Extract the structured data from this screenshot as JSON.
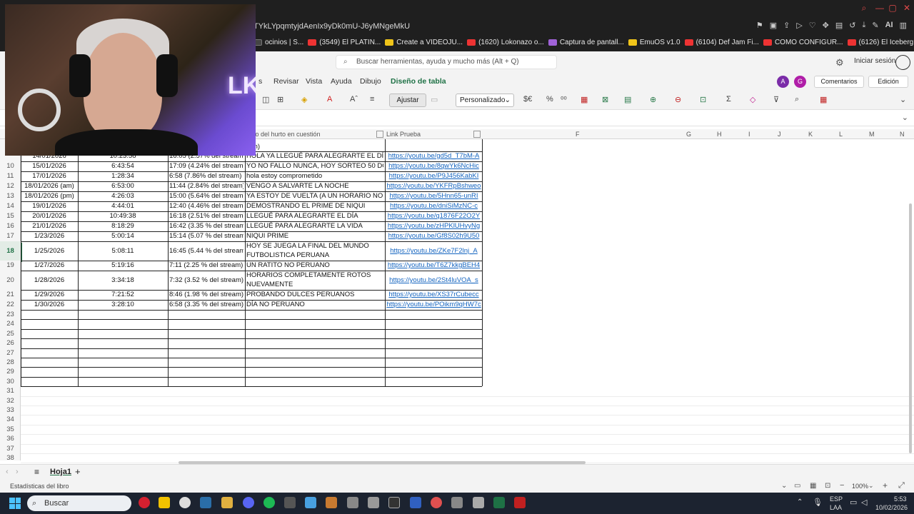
{
  "browser": {
    "url_fragment": "TYkLYpqmtyjdAenIx9yDk0mU-J6yMNgeMkU",
    "bookmarks": [
      {
        "label": "ocinios | S...",
        "icon": "dark"
      },
      {
        "label": "(3549) El PLATIN...",
        "icon": "red"
      },
      {
        "label": "Create a VIDEOJU...",
        "icon": "yellow"
      },
      {
        "label": "(1620) Lokonazo o...",
        "icon": "red"
      },
      {
        "label": "Captura de pantall...",
        "icon": "purple"
      },
      {
        "label": "EmuOS v1.0",
        "icon": "yellow"
      },
      {
        "label": "(6104) Def Jam Fi...",
        "icon": "red"
      },
      {
        "label": "COMO CONFIGUR...",
        "icon": "red"
      },
      {
        "label": "(6126) El Iceberg...",
        "icon": "red"
      }
    ],
    "ai_label": "AI"
  },
  "excel": {
    "search_placeholder": "Buscar herramientas, ayuda y mucho más (Alt + Q)",
    "signin": "Iniciar sesión",
    "menu": {
      "tab_s": "s",
      "revisar": "Revisar",
      "vista": "Vista",
      "ayuda": "Ayuda",
      "dibujo": "Dibujo",
      "diseno": "Diseño de tabla"
    },
    "comments": "Comentarios",
    "edit_mode": "Edición",
    "toolbar": {
      "ajustar": "Ajustar",
      "format": "Personalizado"
    },
    "col_headers": {
      "d": "to del hurto en cuestión",
      "e": "Link Prueba",
      "f": "F",
      "g": "G",
      "h": "H",
      "i": "I",
      "j": "J",
      "k": "K",
      "l": "L",
      "m": "M",
      "n": "N"
    },
    "partial_row_top": {
      "a": "14/01/2026",
      "b": "10:23:58",
      "c": "16:05 (2.57% del stream)",
      "d": "HOLA YA LLEGUÉ PARA ALEGRARTE EL DÍA",
      "e": "https://youtu.be/gd5d_T7bM-A",
      "d_above": "ean)"
    },
    "rows": [
      {
        "n": "10",
        "date": "15/01/2026",
        "duration": "6:43:54",
        "time": "17:09 (4.24% del stream)",
        "title": "YO NO FALLO NUNCA, HOY SORTEO 50 DOLARES",
        "link": "https://youtu.be/8qwYk6NcHic"
      },
      {
        "n": "11",
        "date": "17/01/2026",
        "duration": "1:28:34",
        "time": "6:58 (7.86% del stream)",
        "title": "hola estoy comprometido",
        "link": "https://youtu.be/P9J456KabKI"
      },
      {
        "n": "12",
        "date": "18/01/2026 (am)",
        "duration": "6:53:00",
        "time": "11:44 (2.84% del stream)",
        "title": "VENGO A SALVARTE LA NOCHE",
        "link": "https://youtu.be/YKFRpBshweo"
      },
      {
        "n": "13",
        "date": "18/01/2026 (pm)",
        "duration": "4:26:03",
        "time": "15:00 (5.64% del stream)",
        "title": "YA ESTOY DE VUELTA (A UN HORARIO NORMAL)",
        "link": "https://youtu.be/5Hnn65-unRI"
      },
      {
        "n": "14",
        "date": "19/01/2026",
        "duration": "4:44:01",
        "time": "12:40 (4.46% del stream)",
        "title": "DEMOSTRANDO EL PRIME DE NIQUI",
        "link": "https://youtu.be/dniSiMzNC-c"
      },
      {
        "n": "15",
        "date": "20/01/2026",
        "duration": "10:49:38",
        "time": "16:18 (2.51% del stream)",
        "title": "LLEGUÉ PARA ALEGRARTE EL DÍA",
        "link": "https://youtu.be/q1876F22O2Y"
      },
      {
        "n": "16",
        "date": "21/01/2026",
        "duration": "8:18:29",
        "time": "16:42 (3.35 % del stream)",
        "title": "LLEGUÉ PARA ALEGRARTE LA VIDA",
        "link": "https://youtu.be/zHPKlUHvyNg"
      },
      {
        "n": "17",
        "date": "1/23/2026",
        "duration": "5:00:14",
        "time": "15:14 (5.07 % del stream)",
        "title": "NIQUI PRIME",
        "link": "https://youtu.be/Gf8S02h9U50"
      },
      {
        "n": "18",
        "date": "1/25/2026",
        "duration": "5:08:11",
        "time": "16:45 (5.44 % del stream)",
        "title": "HOY SE JUEGA LA FINAL DEL MUNDO FUTBOLISTICA PERUANA",
        "link": "https://youtu.be/ZKe7F2lnj_A"
      },
      {
        "n": "19",
        "date": "1/27/2026",
        "duration": "5:19:16",
        "time": "7:11 (2.25 % del stream)",
        "title": "UN RATITO NO PERUANO",
        "link": "https://youtu.be/T6Z7kkgBEH4"
      },
      {
        "n": "20",
        "date": "1/28/2026",
        "duration": "3:34:18",
        "time": "7:32 (3.52 % del stream)",
        "title": "HORARIOS COMPLETAMENTE ROTOS NUEVAMENTE",
        "link": "https://youtu.be/2St4luVOA_s"
      },
      {
        "n": "21",
        "date": "1/29/2026",
        "duration": "7:21:52",
        "time": "8:46 (1.98 % del stream)",
        "title": "PROBANDO DULCES PERUANOS",
        "link": "https://youtu.be/XS37rCubecc"
      },
      {
        "n": "22",
        "date": "1/30/2026",
        "duration": "3:28:10",
        "time": "6:58 (3.35 % del stream)",
        "title": "DÍA NO PERUANO",
        "link": "https://youtu.be/POikm9qHW7c"
      }
    ],
    "empty_rows": [
      "23",
      "24",
      "25",
      "26",
      "27",
      "28",
      "29",
      "30",
      "31",
      "32",
      "33",
      "34",
      "35",
      "36",
      "37",
      "38"
    ],
    "sheet_tab": "Hoja1",
    "status_text": "Estadísticas del libro",
    "zoom": "100%"
  },
  "taskbar": {
    "search_label": "Buscar",
    "lang_top": "ESP",
    "lang_bottom": "LAA",
    "time": "5:53",
    "date": "10/02/2026"
  }
}
